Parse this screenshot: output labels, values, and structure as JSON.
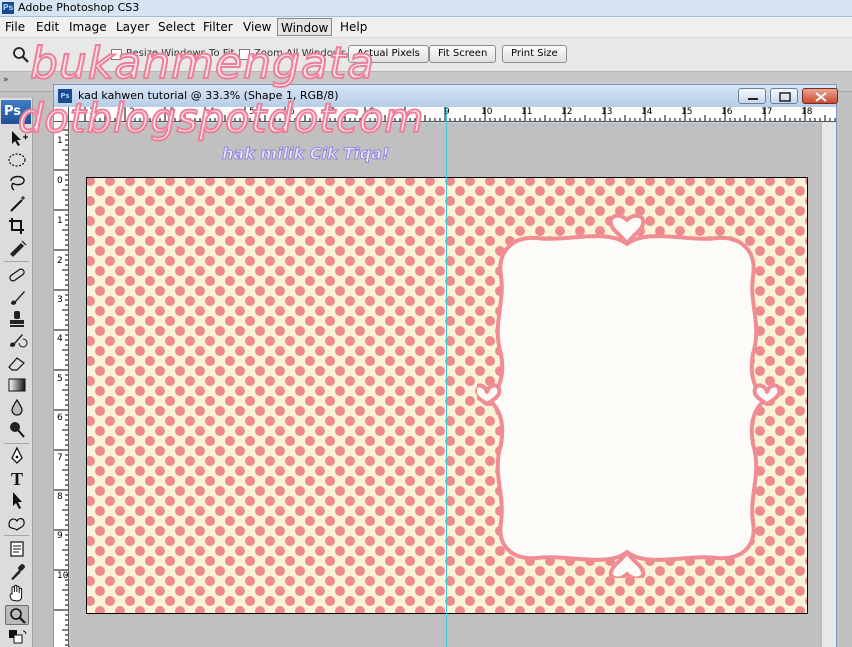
{
  "app": {
    "title": "Adobe Photoshop CS3",
    "ps_badge": "Ps",
    "logo_text": "Ps"
  },
  "menubar": {
    "items": [
      "File",
      "Edit",
      "Image",
      "Layer",
      "Select",
      "Filter",
      "View",
      "Window",
      "Help"
    ],
    "active": "Window"
  },
  "options": {
    "resize_windows_label": "Resize Windows To Fit",
    "zoom_all_label": "Zoom All Windows",
    "actual_pixels_label": "Actual Pixels",
    "fit_screen_label": "Fit Screen",
    "print_size_label": "Print Size"
  },
  "panel_strip": {
    "collapse_glyph": "»"
  },
  "document": {
    "title": "kad kahwen tutorial @ 33.3% (Shape 1, RGB/8)",
    "hruler_labels": [
      "1",
      "2",
      "3",
      "4",
      "5",
      "6",
      "7",
      "8",
      "9",
      "10",
      "11",
      "12",
      "13",
      "14",
      "15",
      "16",
      "17",
      "18"
    ],
    "vruler_labels": [
      "1",
      "0",
      "1",
      "2",
      "3",
      "4",
      "5",
      "6",
      "7",
      "8",
      "9",
      "10"
    ]
  },
  "watermark": {
    "line1": "bukanmengata",
    "line2": "dotblogspotdotcom",
    "line3": "hak milik Cik Tiqa!"
  },
  "colors": {
    "dot_pink": "#ec8a8c",
    "paper_cream": "#fbf3d9",
    "frame_pink": "#f08c93",
    "guide_cyan": "#3fc7d6"
  }
}
